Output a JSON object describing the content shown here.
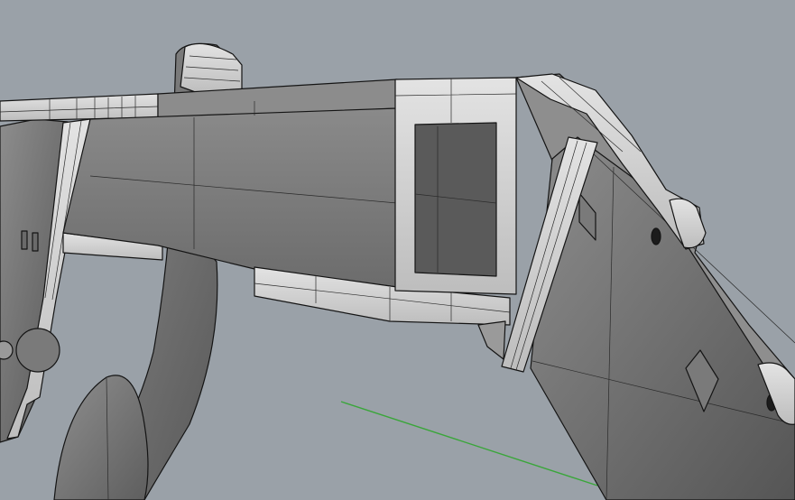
{
  "viewport": {
    "background_color": "#9aa1a8",
    "render_mode": "shaded",
    "colors": {
      "surface_light": "#cfcfcf",
      "surface_mid": "#8f8f8f",
      "surface_dark": "#5a5a5a",
      "edge": "#141414",
      "axis_line": "#3aa63a"
    }
  }
}
